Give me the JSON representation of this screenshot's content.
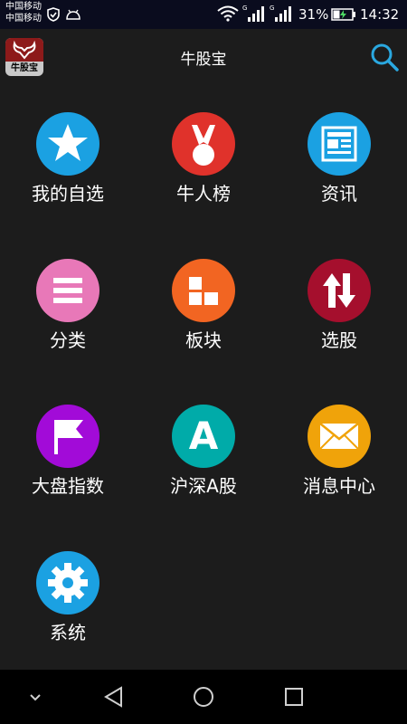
{
  "status_bar": {
    "carrier_1": "中国移动",
    "carrier_2": "中国移动",
    "battery": "31%",
    "time": "14:32",
    "icons": [
      "shield-icon",
      "android-icon",
      "wifi-icon",
      "signal-icon",
      "battery-charging-icon"
    ]
  },
  "app_bar": {
    "logo_text": "牛股宝",
    "title": "牛股宝",
    "search_icon": "search-icon"
  },
  "menu": {
    "items": [
      {
        "label": "我的自选",
        "icon": "star-icon",
        "color": "#1ba1e2"
      },
      {
        "label": "牛人榜",
        "icon": "medal-icon",
        "color": "#e0322b"
      },
      {
        "label": "资讯",
        "icon": "news-icon",
        "color": "#1ba1e2"
      },
      {
        "label": "分类",
        "icon": "list-icon",
        "color": "#e878b8"
      },
      {
        "label": "板块",
        "icon": "blocks-icon",
        "color": "#f26522"
      },
      {
        "label": "选股",
        "icon": "updown-arrows-icon",
        "color": "#a50f2d"
      },
      {
        "label": "大盘指数",
        "icon": "flag-icon",
        "color": "#a20bd8"
      },
      {
        "label": "沪深A股",
        "icon": "letter-a-icon",
        "letter": "A",
        "color": "#00aba9"
      },
      {
        "label": "消息中心",
        "icon": "envelope-icon",
        "color": "#f0a30a"
      },
      {
        "label": "系统",
        "icon": "gear-icon",
        "color": "#1ba1e2"
      }
    ]
  },
  "nav_bar": {
    "buttons": [
      "chevron-down-icon",
      "back-icon",
      "home-icon",
      "recents-icon"
    ]
  }
}
